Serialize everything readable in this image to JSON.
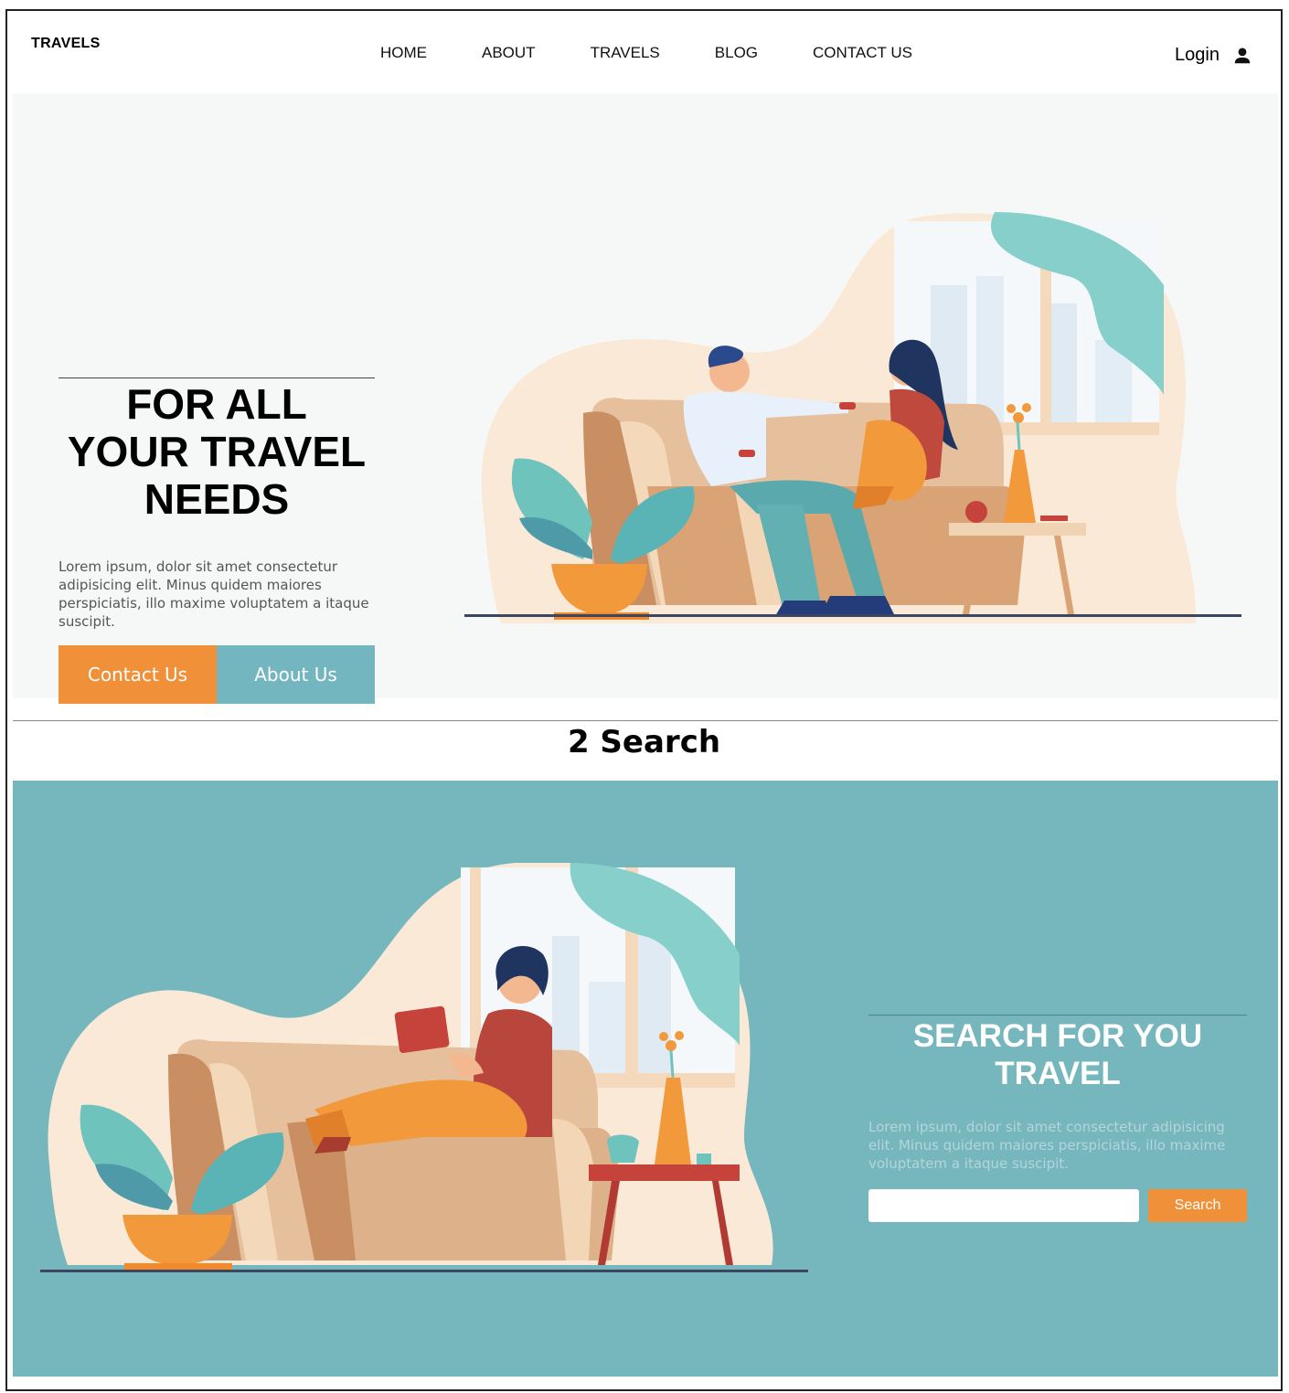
{
  "nav": {
    "brand": "TRAVELS",
    "items": [
      {
        "label": "HOME"
      },
      {
        "label": "ABOUT"
      },
      {
        "label": "TRAVELS"
      },
      {
        "label": "BLOG"
      },
      {
        "label": "CONTACT US"
      }
    ],
    "login_label": "Login",
    "login_icon": "user-icon"
  },
  "hero": {
    "title_line1": "FOR ALL",
    "title_line2": "YOUR TRAVEL",
    "title_line3": "NEEDS",
    "description": "Lorem ipsum, dolor sit amet consectetur adipisicing elit. Minus quidem maiores perspiciatis, illo maxime voluptatem a itaque suscipit.",
    "contact_button": "Contact Us",
    "about_button": "About Us"
  },
  "section": {
    "title": "2 Search"
  },
  "search": {
    "title_line1": "SEARCH FOR YOU",
    "title_line2": "TRAVEL",
    "description": "Lorem ipsum, dolor sit amet consectetur adipisicing elit. Minus quidem maiores perspiciatis, illo maxime voluptatem a itaque suscipit.",
    "input_value": "",
    "button_label": "Search"
  },
  "colors": {
    "accent_orange": "#f0913a",
    "teal": "#74b6bf",
    "search_bg": "#76b6bd"
  }
}
